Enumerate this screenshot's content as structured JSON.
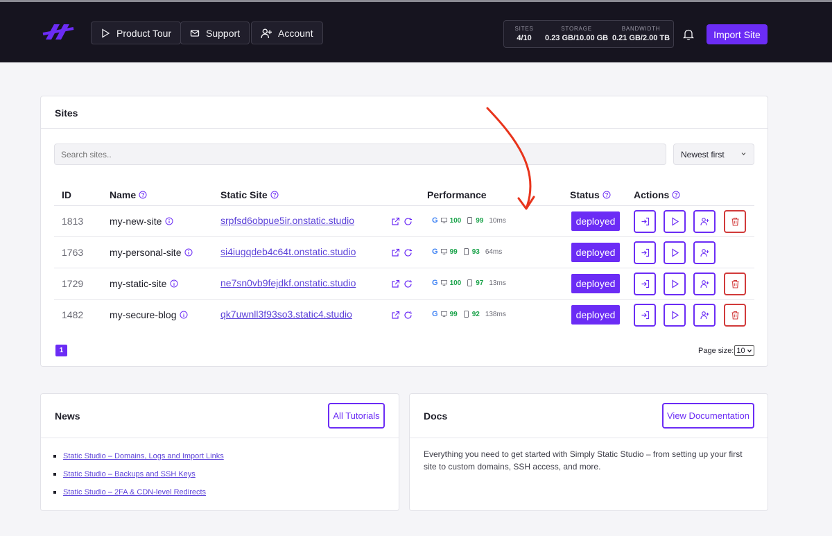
{
  "header": {
    "nav": [
      {
        "label": "Product Tour",
        "icon": "play-icon"
      },
      {
        "label": "Support",
        "icon": "mail-icon"
      },
      {
        "label": "Account",
        "icon": "add-user-icon"
      }
    ],
    "stats": [
      {
        "label": "SITES",
        "value": "4/10"
      },
      {
        "label": "STORAGE",
        "value": "0.23 GB/10.00 GB"
      },
      {
        "label": "BANDWIDTH",
        "value": "0.21 GB/2.00 TB"
      }
    ],
    "import_label": "Import Site"
  },
  "sites": {
    "title": "Sites",
    "search_placeholder": "Search sites..",
    "sort_value": "Newest first",
    "columns": {
      "id": "ID",
      "name": "Name",
      "static_site": "Static Site",
      "performance": "Performance",
      "status": "Status",
      "actions": "Actions"
    },
    "rows": [
      {
        "id": "1813",
        "name": "my-new-site",
        "url": "srpfsd6obpue5ir.onstatic.studio",
        "desktop": "100",
        "mobile": "99",
        "time": "10ms",
        "status": "deployed",
        "deletable": true
      },
      {
        "id": "1763",
        "name": "my-personal-site",
        "url": "si4iugqdeb4c64t.onstatic.studio",
        "desktop": "99",
        "mobile": "93",
        "time": "64ms",
        "status": "deployed",
        "deletable": false
      },
      {
        "id": "1729",
        "name": "my-static-site",
        "url": "ne7sn0vb9fejdkf.onstatic.studio",
        "desktop": "100",
        "mobile": "97",
        "time": "13ms",
        "status": "deployed",
        "deletable": true
      },
      {
        "id": "1482",
        "name": "my-secure-blog",
        "url": "qk7uwnll3f93so3.static4.studio",
        "desktop": "99",
        "mobile": "92",
        "time": "138ms",
        "status": "deployed",
        "deletable": true
      }
    ],
    "page": "1",
    "page_size_label": "Page size:",
    "page_size_value": "10"
  },
  "news": {
    "title": "News",
    "button": "All Tutorials",
    "items": [
      "Static Studio – Domains, Logs and Import Links",
      "Static Studio – Backups and SSH Keys",
      "Static Studio – 2FA & CDN-level Redirects"
    ]
  },
  "docs": {
    "title": "Docs",
    "button": "View Documentation",
    "text": "Everything you need to get started with Simply Static Studio – from setting up your first site to custom domains, SSH access, and more."
  },
  "colors": {
    "accent": "#6b2cf5",
    "header_bg": "#16141f",
    "danger": "#d13a3a",
    "score_green": "#1aa34a",
    "annotation_arrow": "#e8341c"
  }
}
